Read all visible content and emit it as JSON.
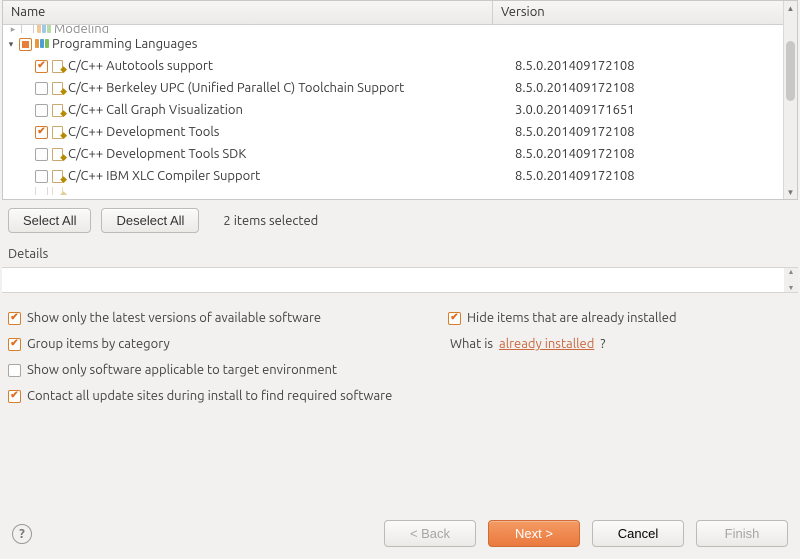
{
  "columns": {
    "name": "Name",
    "version": "Version"
  },
  "tree": {
    "partial_top_row": {
      "label": "Modeling"
    },
    "category": {
      "label": "Programming Languages",
      "expanded": true,
      "children": [
        {
          "checked": true,
          "label": "C/C++ Autotools support",
          "version": "8.5.0.201409172108"
        },
        {
          "checked": false,
          "label": "C/C++ Berkeley UPC (Unified Parallel C) Toolchain Support",
          "version": "8.5.0.201409172108"
        },
        {
          "checked": false,
          "label": "C/C++ Call Graph Visualization",
          "version": "3.0.0.201409171651"
        },
        {
          "checked": true,
          "label": "C/C++ Development Tools",
          "version": "8.5.0.201409172108"
        },
        {
          "checked": false,
          "label": "C/C++ Development Tools SDK",
          "version": "8.5.0.201409172108"
        },
        {
          "checked": false,
          "label": "C/C++ IBM XLC Compiler Support",
          "version": "8.5.0.201409172108"
        }
      ]
    }
  },
  "toolbar": {
    "select_all": "Select All",
    "deselect_all": "Deselect All",
    "status": "2 items selected"
  },
  "details_label": "Details",
  "options": {
    "latest": {
      "checked": true,
      "label": "Show only the latest versions of available software"
    },
    "hide": {
      "checked": true,
      "label": "Hide items that are already installed"
    },
    "group": {
      "checked": true,
      "label": "Group items by category"
    },
    "whatis_prefix": "What is ",
    "whatis_link": "already installed",
    "whatis_suffix": "?",
    "target": {
      "checked": false,
      "label": "Show only software applicable to target environment"
    },
    "contact": {
      "checked": true,
      "label": "Contact all update sites during install to find required software"
    }
  },
  "buttons": {
    "back": "< Back",
    "next": "Next >",
    "cancel": "Cancel",
    "finish": "Finish"
  }
}
